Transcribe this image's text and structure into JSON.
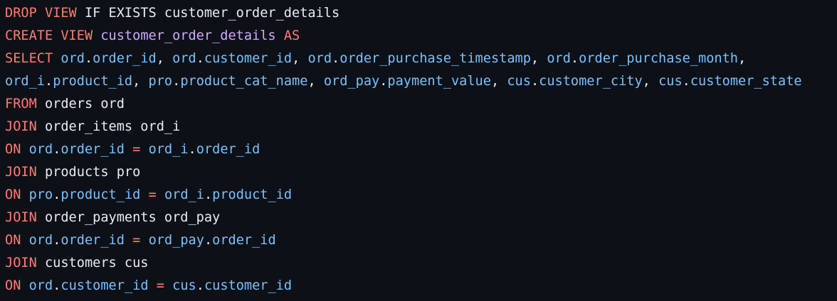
{
  "editor": {
    "language": "sql",
    "colors": {
      "background": "#0d1117",
      "keyword": "#ff7b72",
      "plain": "#e6edf3",
      "entity": "#d2a8ff",
      "identifier": "#79c0ff"
    },
    "lines": [
      {
        "tokens": [
          {
            "t": "DROP VIEW",
            "c": "keyword"
          },
          {
            "t": " IF EXISTS customer_order_details",
            "c": "plain"
          }
        ]
      },
      {
        "tokens": [
          {
            "t": "CREATE VIEW",
            "c": "keyword"
          },
          {
            "t": " ",
            "c": "plain"
          },
          {
            "t": "customer_order_details",
            "c": "entity"
          },
          {
            "t": " ",
            "c": "plain"
          },
          {
            "t": "AS",
            "c": "keyword"
          }
        ]
      },
      {
        "tokens": [
          {
            "t": "SELECT",
            "c": "keyword"
          },
          {
            "t": " ",
            "c": "plain"
          },
          {
            "t": "ord",
            "c": "ident"
          },
          {
            "t": ".",
            "c": "plain"
          },
          {
            "t": "order_id",
            "c": "ident"
          },
          {
            "t": ", ",
            "c": "plain"
          },
          {
            "t": "ord",
            "c": "ident"
          },
          {
            "t": ".",
            "c": "plain"
          },
          {
            "t": "customer_id",
            "c": "ident"
          },
          {
            "t": ", ",
            "c": "plain"
          },
          {
            "t": "ord",
            "c": "ident"
          },
          {
            "t": ".",
            "c": "plain"
          },
          {
            "t": "order_purchase_timestamp",
            "c": "ident"
          },
          {
            "t": ", ",
            "c": "plain"
          },
          {
            "t": "ord",
            "c": "ident"
          },
          {
            "t": ".",
            "c": "plain"
          },
          {
            "t": "order_purchase_month",
            "c": "ident"
          },
          {
            "t": ",",
            "c": "plain"
          }
        ]
      },
      {
        "tokens": [
          {
            "t": "ord_i",
            "c": "ident"
          },
          {
            "t": ".",
            "c": "plain"
          },
          {
            "t": "product_id",
            "c": "ident"
          },
          {
            "t": ", ",
            "c": "plain"
          },
          {
            "t": "pro",
            "c": "ident"
          },
          {
            "t": ".",
            "c": "plain"
          },
          {
            "t": "product_cat_name",
            "c": "ident"
          },
          {
            "t": ", ",
            "c": "plain"
          },
          {
            "t": "ord_pay",
            "c": "ident"
          },
          {
            "t": ".",
            "c": "plain"
          },
          {
            "t": "payment_value",
            "c": "ident"
          },
          {
            "t": ", ",
            "c": "plain"
          },
          {
            "t": "cus",
            "c": "ident"
          },
          {
            "t": ".",
            "c": "plain"
          },
          {
            "t": "customer_city",
            "c": "ident"
          },
          {
            "t": ", ",
            "c": "plain"
          },
          {
            "t": "cus",
            "c": "ident"
          },
          {
            "t": ".",
            "c": "plain"
          },
          {
            "t": "customer_state",
            "c": "ident"
          }
        ]
      },
      {
        "tokens": [
          {
            "t": "FROM",
            "c": "keyword"
          },
          {
            "t": " orders ord",
            "c": "plain"
          }
        ]
      },
      {
        "tokens": [
          {
            "t": "JOIN",
            "c": "keyword"
          },
          {
            "t": " order_items ord_i",
            "c": "plain"
          }
        ]
      },
      {
        "tokens": [
          {
            "t": "ON",
            "c": "keyword"
          },
          {
            "t": " ",
            "c": "plain"
          },
          {
            "t": "ord",
            "c": "ident"
          },
          {
            "t": ".",
            "c": "plain"
          },
          {
            "t": "order_id",
            "c": "ident"
          },
          {
            "t": " ",
            "c": "plain"
          },
          {
            "t": "=",
            "c": "keyword"
          },
          {
            "t": " ",
            "c": "plain"
          },
          {
            "t": "ord_i",
            "c": "ident"
          },
          {
            "t": ".",
            "c": "plain"
          },
          {
            "t": "order_id",
            "c": "ident"
          }
        ]
      },
      {
        "tokens": [
          {
            "t": "JOIN",
            "c": "keyword"
          },
          {
            "t": " products pro",
            "c": "plain"
          }
        ]
      },
      {
        "tokens": [
          {
            "t": "ON",
            "c": "keyword"
          },
          {
            "t": " ",
            "c": "plain"
          },
          {
            "t": "pro",
            "c": "ident"
          },
          {
            "t": ".",
            "c": "plain"
          },
          {
            "t": "product_id",
            "c": "ident"
          },
          {
            "t": " ",
            "c": "plain"
          },
          {
            "t": "=",
            "c": "keyword"
          },
          {
            "t": " ",
            "c": "plain"
          },
          {
            "t": "ord_i",
            "c": "ident"
          },
          {
            "t": ".",
            "c": "plain"
          },
          {
            "t": "product_id",
            "c": "ident"
          }
        ]
      },
      {
        "tokens": [
          {
            "t": "JOIN",
            "c": "keyword"
          },
          {
            "t": " order_payments ord_pay",
            "c": "plain"
          }
        ]
      },
      {
        "tokens": [
          {
            "t": "ON",
            "c": "keyword"
          },
          {
            "t": " ",
            "c": "plain"
          },
          {
            "t": "ord",
            "c": "ident"
          },
          {
            "t": ".",
            "c": "plain"
          },
          {
            "t": "order_id",
            "c": "ident"
          },
          {
            "t": " ",
            "c": "plain"
          },
          {
            "t": "=",
            "c": "keyword"
          },
          {
            "t": " ",
            "c": "plain"
          },
          {
            "t": "ord_pay",
            "c": "ident"
          },
          {
            "t": ".",
            "c": "plain"
          },
          {
            "t": "order_id",
            "c": "ident"
          }
        ]
      },
      {
        "tokens": [
          {
            "t": "JOIN",
            "c": "keyword"
          },
          {
            "t": " customers cus",
            "c": "plain"
          }
        ]
      },
      {
        "tokens": [
          {
            "t": "ON",
            "c": "keyword"
          },
          {
            "t": " ",
            "c": "plain"
          },
          {
            "t": "ord",
            "c": "ident"
          },
          {
            "t": ".",
            "c": "plain"
          },
          {
            "t": "customer_id",
            "c": "ident"
          },
          {
            "t": " ",
            "c": "plain"
          },
          {
            "t": "=",
            "c": "keyword"
          },
          {
            "t": " ",
            "c": "plain"
          },
          {
            "t": "cus",
            "c": "ident"
          },
          {
            "t": ".",
            "c": "plain"
          },
          {
            "t": "customer_id",
            "c": "ident"
          }
        ]
      }
    ]
  }
}
